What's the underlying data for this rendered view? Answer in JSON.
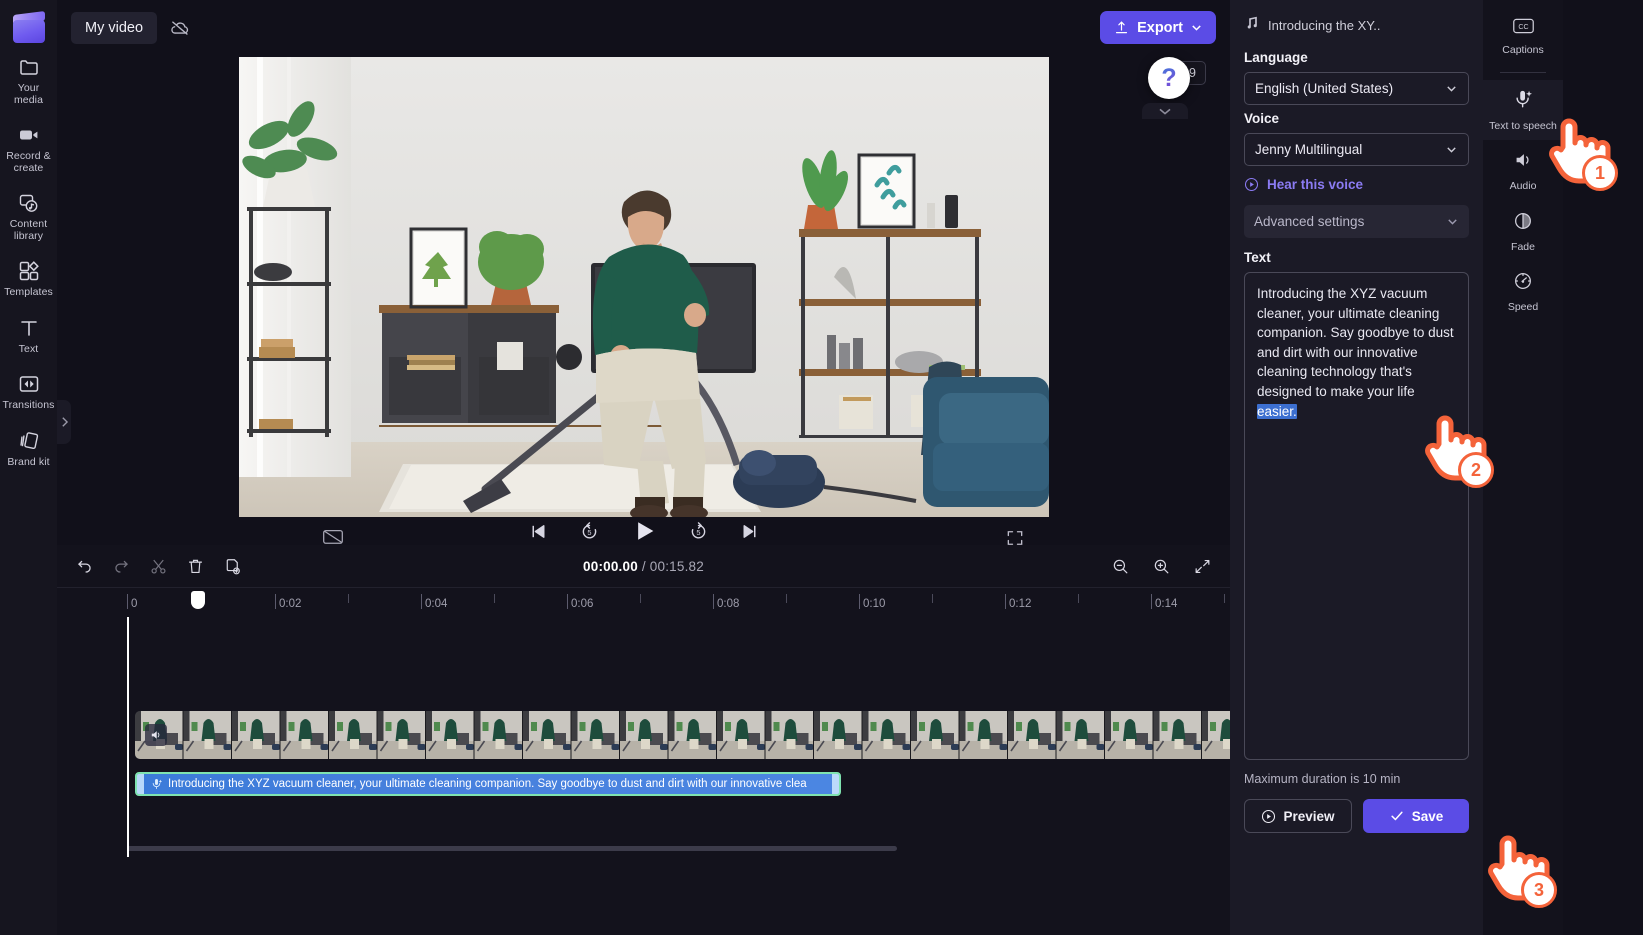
{
  "app": {
    "brand_accent": "#5b4ce6",
    "background": "#11101a",
    "panel_background": "#1b1a26"
  },
  "left_rail": {
    "logo_name": "clipchamp-logo",
    "items": [
      {
        "label": "Your media",
        "icon": "folder-icon"
      },
      {
        "label": "Record & create",
        "icon": "video-camera-icon"
      },
      {
        "label": "Content library",
        "icon": "content-library-icon"
      },
      {
        "label": "Templates",
        "icon": "templates-icon"
      },
      {
        "label": "Text",
        "icon": "text-icon"
      },
      {
        "label": "Transitions",
        "icon": "transitions-icon"
      },
      {
        "label": "Brand kit",
        "icon": "brand-kit-icon"
      }
    ]
  },
  "topbar": {
    "project_name": "My video",
    "cloud_icon": "cloud-off-icon",
    "export_label": "Export",
    "export_icon": "upload-icon",
    "export_chevron": "chevron-down-icon"
  },
  "stage": {
    "aspect_ratio": "16:9",
    "captions_toggle_icon": "captions-off-icon",
    "fullscreen_icon": "fullscreen-icon",
    "help_label": "?",
    "controls": [
      {
        "name": "skip-to-start-button",
        "icon": "skip-previous-icon"
      },
      {
        "name": "rewind-5-button",
        "icon": "replay-5-icon"
      },
      {
        "name": "play-button",
        "icon": "play-icon"
      },
      {
        "name": "forward-5-button",
        "icon": "forward-5-icon"
      },
      {
        "name": "skip-to-end-button",
        "icon": "skip-next-icon"
      }
    ]
  },
  "timeline": {
    "tools": [
      {
        "name": "undo-button",
        "icon": "undo-icon"
      },
      {
        "name": "redo-button",
        "icon": "redo-icon"
      },
      {
        "name": "split-button",
        "icon": "scissors-icon"
      },
      {
        "name": "delete-button",
        "icon": "trash-icon"
      },
      {
        "name": "duplicate-button",
        "icon": "duplicate-icon"
      }
    ],
    "current_time": "00:00.00",
    "separator": "/",
    "total_time": "00:15.82",
    "zoom_out_icon": "zoom-out-icon",
    "zoom_in_icon": "zoom-in-icon",
    "fit_icon": "fit-to-timeline-icon",
    "ruler_labels": [
      "0",
      "0:02",
      "0:04",
      "0:06",
      "0:08",
      "0:10",
      "0:12",
      "0:14"
    ],
    "video_track": {
      "name": "video-clip",
      "volume_icon": "volume-icon"
    },
    "tts_clip": {
      "icon": "text-to-speech-icon",
      "label": "Introducing the XYZ vacuum cleaner, your ultimate cleaning companion. Say goodbye to dust and dirt with our innovative clea"
    }
  },
  "properties": {
    "header_icon": "audio-note-icon",
    "header_title": "Introducing the XY..",
    "language_label": "Language",
    "language_value": "English (United States)",
    "voice_label": "Voice",
    "voice_value": "Jenny Multilingual",
    "hear_voice_label": "Hear this voice",
    "hear_voice_icon": "play-circle-icon",
    "advanced_settings_label": "Advanced settings",
    "text_label": "Text",
    "text_value_before": "Introducing the XYZ vacuum cleaner, your ultimate cleaning companion. Say goodbye to dust and dirt with our innovative cleaning technology that's designed to make your life ",
    "text_value_selected": "easier.",
    "max_duration_note": "Maximum duration is 10 min",
    "preview_label": "Preview",
    "preview_icon": "play-circle-icon",
    "save_label": "Save",
    "save_icon": "check-icon"
  },
  "tool_rail": {
    "items": [
      {
        "label": "Captions",
        "icon": "cc-icon",
        "active": false
      },
      {
        "label": "Text to speech",
        "icon": "text-to-speech-icon",
        "active": true
      },
      {
        "label": "Audio",
        "icon": "audio-icon",
        "active": false
      },
      {
        "label": "Fade",
        "icon": "fade-icon",
        "active": false
      },
      {
        "label": "Speed",
        "icon": "speedometer-icon",
        "active": false
      }
    ]
  },
  "annotations": {
    "steps": [
      "1",
      "2",
      "3"
    ],
    "accent": "#f4633a"
  }
}
